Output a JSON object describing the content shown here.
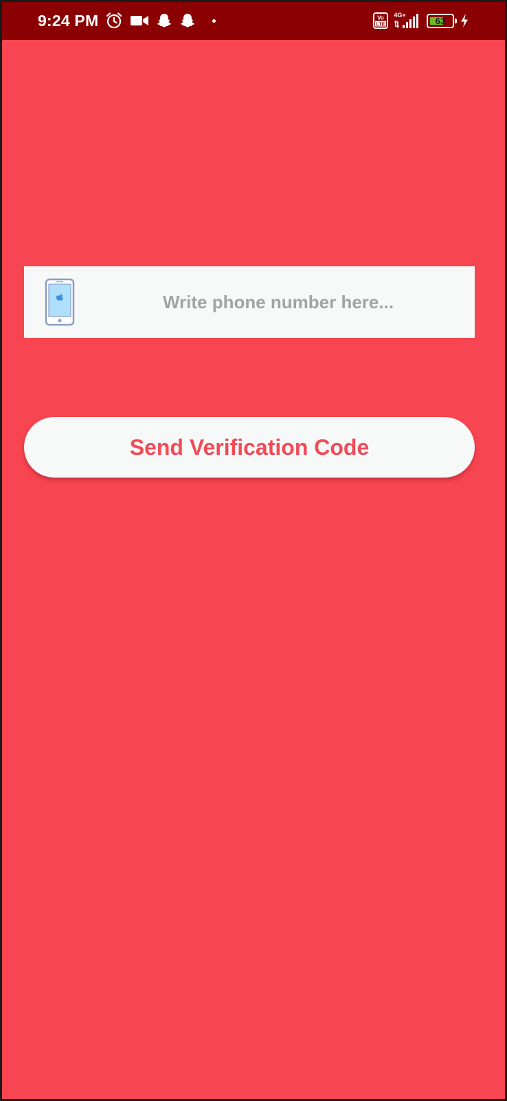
{
  "status_bar": {
    "time": "9:24 PM",
    "network": "4G+",
    "volte_top": "Vo",
    "volte_bottom": "LTE",
    "battery_level": "63",
    "battery_fraction": 0.63,
    "left_icons": [
      "alarm-icon",
      "video-camera-icon",
      "snapchat-icon",
      "snapchat-icon",
      "notification-dot-icon"
    ],
    "right_icons": [
      "volte-icon",
      "signal-icon",
      "battery-icon",
      "charging-bolt-icon"
    ]
  },
  "phone_field": {
    "icon": "smartphone-icon",
    "placeholder": "Write phone number here...",
    "value": ""
  },
  "send_button": {
    "label": "Send Verification Code"
  },
  "colors": {
    "background": "#f74551",
    "status_bar": "#8b0000",
    "field_background": "#f7f8f8",
    "button_text": "#f24a56",
    "placeholder": "#a3a3a3"
  }
}
